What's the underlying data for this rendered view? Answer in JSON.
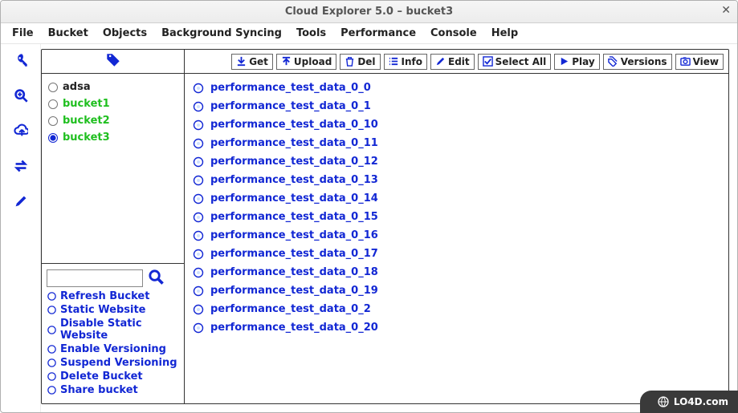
{
  "window": {
    "title": "Cloud Explorer 5.0 –  bucket3"
  },
  "menubar": {
    "items": [
      "File",
      "Bucket",
      "Objects",
      "Background Syncing",
      "Tools",
      "Performance",
      "Console",
      "Help"
    ]
  },
  "left_icons": [
    "key-icon",
    "zoom-in-icon",
    "upload-cloud-icon",
    "sync-icon",
    "edit-icon"
  ],
  "toolbar": {
    "get": "Get",
    "upload": "Upload",
    "del": "Del",
    "info": "Info",
    "edit": "Edit",
    "select_all": "Select All",
    "play": "Play",
    "versions": "Versions",
    "view": "View"
  },
  "buckets": [
    {
      "name": "adsa",
      "selected": false,
      "green": false
    },
    {
      "name": "bucket1",
      "selected": false,
      "green": true
    },
    {
      "name": "bucket2",
      "selected": false,
      "green": true
    },
    {
      "name": "bucket3",
      "selected": true,
      "green": true
    }
  ],
  "search": {
    "value": "",
    "placeholder": ""
  },
  "bucket_actions": [
    "Refresh Bucket",
    "Static Website",
    "Disable Static Website",
    "Enable Versioning",
    "Suspend Versioning",
    "Delete Bucket",
    "Share bucket"
  ],
  "files": [
    "performance_test_data_0_0",
    "performance_test_data_0_1",
    "performance_test_data_0_10",
    "performance_test_data_0_11",
    "performance_test_data_0_12",
    "performance_test_data_0_13",
    "performance_test_data_0_14",
    "performance_test_data_0_15",
    "performance_test_data_0_16",
    "performance_test_data_0_17",
    "performance_test_data_0_18",
    "performance_test_data_0_19",
    "performance_test_data_0_2",
    "performance_test_data_0_20"
  ],
  "badge": {
    "text": "LO4D.com"
  },
  "colors": {
    "accent": "#1227d4",
    "green": "#1fbf1f"
  }
}
